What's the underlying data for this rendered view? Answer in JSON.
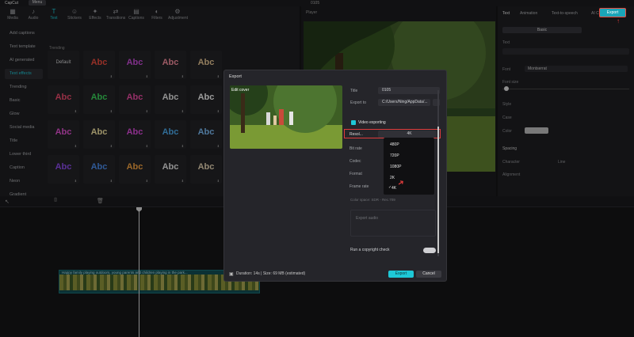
{
  "topbar": {
    "app": "CapCut",
    "menu": "Menu",
    "project_title": "0105"
  },
  "top_export_label": "Export",
  "toolbar": [
    {
      "label": "Media",
      "icon": "media-icon"
    },
    {
      "label": "Audio",
      "icon": "audio-icon"
    },
    {
      "label": "Text",
      "icon": "text-icon"
    },
    {
      "label": "Stickers",
      "icon": "sticker-icon"
    },
    {
      "label": "Effects",
      "icon": "effects-icon"
    },
    {
      "label": "Transitions",
      "icon": "transition-icon"
    },
    {
      "label": "Captions",
      "icon": "captions-icon"
    },
    {
      "label": "Filters",
      "icon": "filter-icon"
    },
    {
      "label": "Adjustment",
      "icon": "adjust-icon"
    }
  ],
  "categories": [
    "Add captions",
    "Text template",
    "AI generated",
    "Text effects",
    "Trending",
    "Basic",
    "Glow",
    "Social media",
    "Title",
    "Lower third",
    "Caption",
    "Neon",
    "Gradient"
  ],
  "section_label": "Trending",
  "tile_labels": [
    "Default",
    "Abc",
    "Abc",
    "Abc",
    "Abc",
    "Abc",
    "Abc",
    "Abc",
    "Abc",
    "Abc",
    "Abc",
    "Abc",
    "Abc",
    "Abc",
    "Abc",
    "Abc",
    "Abc",
    "Abc",
    "Abc",
    "Abc",
    "Abc",
    "Abc",
    "Abc",
    "Abc",
    "Abc"
  ],
  "player_label": "Player",
  "props": {
    "tabs": [
      "Text",
      "Animation",
      "Text-to-speech",
      "AI Characters"
    ],
    "basic": "Basic",
    "rows": [
      "Text",
      "Font",
      "Font size",
      "Style",
      "Case",
      "Color",
      "Spacing",
      "Character",
      "Line",
      "Alignment"
    ],
    "font_value": "Montserrat"
  },
  "modal": {
    "header": "Export",
    "edit_cover": "Edit cover",
    "title_label": "Title",
    "title_value": "0105",
    "export_to_label": "Export to",
    "export_to_value": "C:/Users/Ning/AppData/...",
    "video_exporting": "Video exporting",
    "resolution_label": "Resol...",
    "resolution_value": "4K",
    "bitrate_label": "Bit rate",
    "codec_label": "Codec",
    "format_label": "Format",
    "framerate_label": "Frame rate",
    "resolution_options": [
      "480P",
      "720P",
      "1080P",
      "2K",
      "4K"
    ],
    "color_space": "Color space: SDR - Rec.709",
    "export_audio": "Export audio",
    "copyright_check": "Run a copyright check",
    "footer": "Duration: 14s | Size: 69 MB (estimated)",
    "export_btn": "Export",
    "cancel_btn": "Cancel"
  },
  "clip_label": "Happy family playing outdoors, young parents and children playing in the park...",
  "colors": {
    "accent": "#1ec8d6",
    "highlight": "#e03c3c"
  }
}
